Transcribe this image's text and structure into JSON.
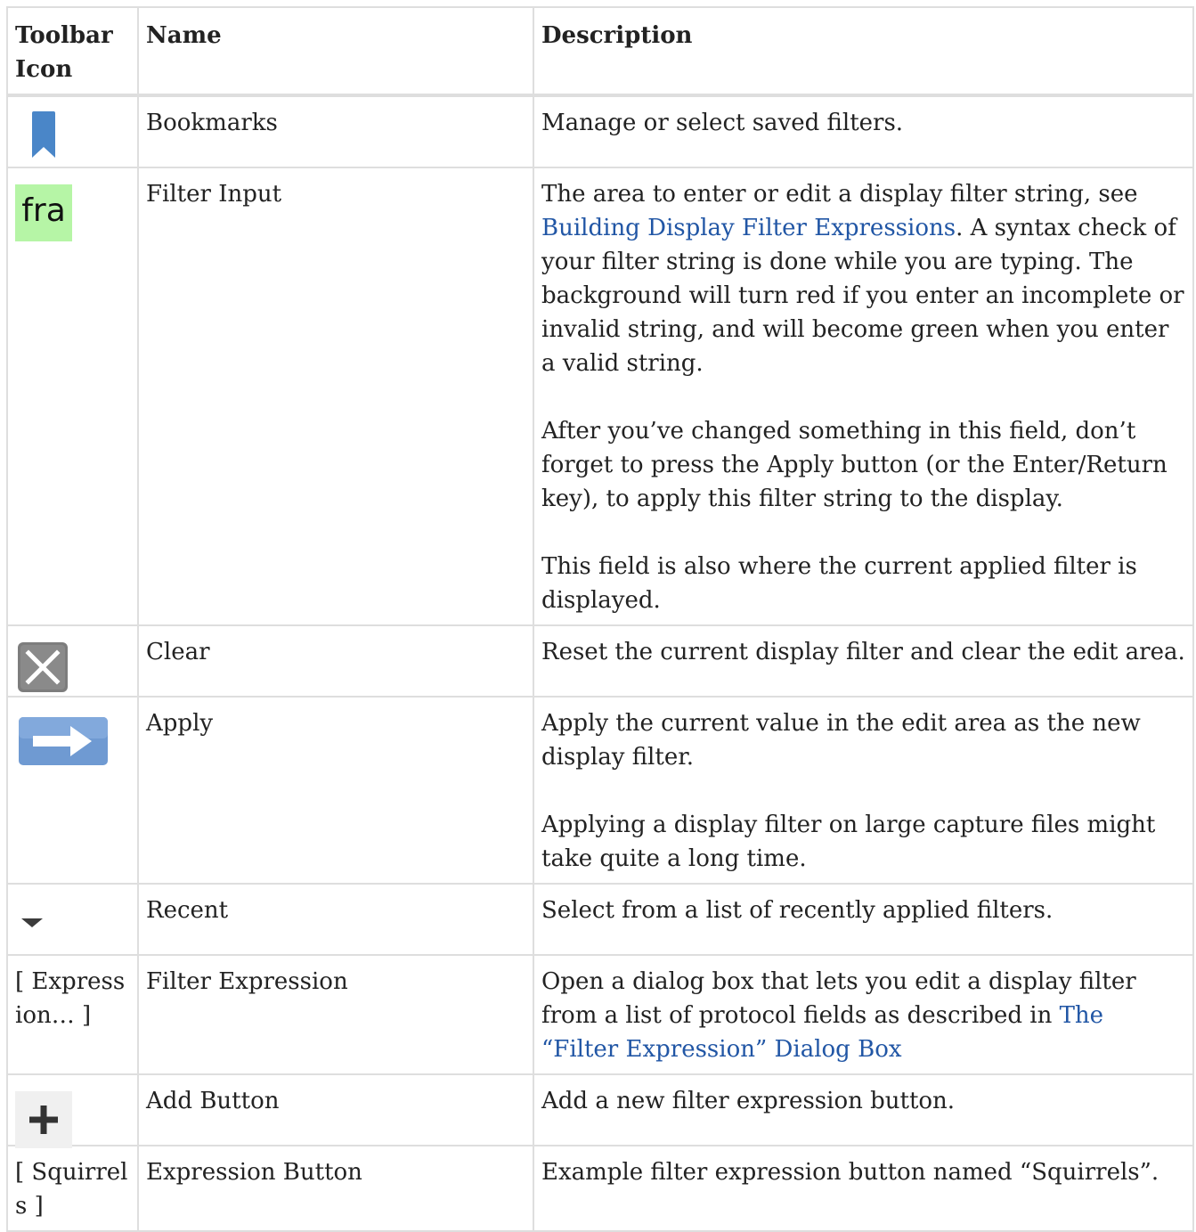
{
  "table": {
    "headers": {
      "icon": "Toolbar Icon",
      "name": "Name",
      "description": "Description"
    },
    "rows": [
      {
        "icon_name": "bookmark-icon",
        "name": "Bookmarks",
        "description": [
          "Manage or select saved filters."
        ]
      },
      {
        "icon_name": "filter-input-icon",
        "icon_text": "fra",
        "name": "Filter Input",
        "description_p1_before": "The area to enter or edit a display filter string, see ",
        "description_p1_link": "Building Display Filter Expressions",
        "description_p1_after": ". A syntax check of your filter string is done while you are typing. The background will turn red if you enter an incomplete or invalid string, and will become green when you enter a valid string.",
        "description_p2": "After you’ve changed something in this field, don’t forget to press the Apply button (or the Enter/Return key), to apply this filter string to the display.",
        "description_p3": "This field is also where the current applied filter is displayed."
      },
      {
        "icon_name": "clear-icon",
        "name": "Clear",
        "description": [
          "Reset the current display filter and clear the edit area."
        ]
      },
      {
        "icon_name": "apply-arrow-icon",
        "name": "Apply",
        "description": [
          "Apply the current value in the edit area as the new display filter.",
          "Applying a display filter on large capture files might take quite a long time."
        ]
      },
      {
        "icon_name": "dropdown-arrow-icon",
        "name": "Recent",
        "description": [
          "Select from a list of recently applied filters."
        ]
      },
      {
        "icon_text": "[ Expression… ]",
        "name": "Filter Expression",
        "description_before": "Open a dialog box that lets you edit a display filter from a list of protocol fields as described in ",
        "description_link": "The “Filter Expression” Dialog Box"
      },
      {
        "icon_name": "plus-icon",
        "name": "Add Button",
        "description": [
          "Add a new filter expression button."
        ]
      },
      {
        "icon_text": "[ Squirrels ]",
        "name": "Expression Button",
        "description": [
          "Example filter expression button named “Squirrels”."
        ]
      }
    ]
  },
  "colors": {
    "link": "#2156a5",
    "bookmark": "#4a86c8",
    "filter_input_bg": "#b6f5a6",
    "clear_bg": "#7d7d7d",
    "apply_bg": "#6f9ad2"
  }
}
